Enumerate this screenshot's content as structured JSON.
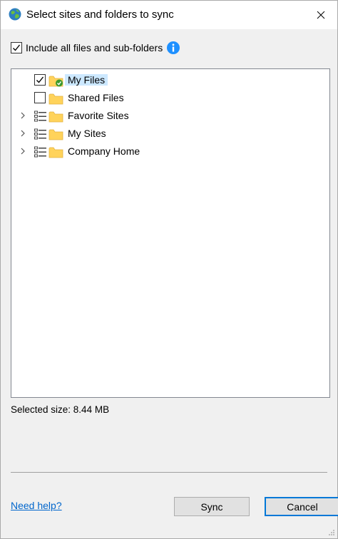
{
  "window": {
    "title": "Select sites and folders to sync"
  },
  "include_option": {
    "label": "Include all files and sub-folders",
    "checked": true
  },
  "tree": {
    "items": [
      {
        "label": "My Files",
        "checked": true,
        "expandable": false,
        "selected": true,
        "status": "synced"
      },
      {
        "label": "Shared Files",
        "checked": false,
        "expandable": false,
        "selected": false
      },
      {
        "label": "Favorite Sites",
        "expandable": true,
        "selected": false
      },
      {
        "label": "My Sites",
        "expandable": true,
        "selected": false
      },
      {
        "label": "Company Home",
        "expandable": true,
        "selected": false
      }
    ]
  },
  "selected_size": "Selected size: 8.44 MB",
  "footer": {
    "help_link": "Need help?",
    "sync_label": "Sync",
    "cancel_label": "Cancel"
  },
  "colors": {
    "selection": "#cce8ff",
    "folder": "#ffd35b",
    "accent": "#0078d7",
    "link": "#0066cc",
    "info": "#1e90ff",
    "synced_badge": "#3c9a2e"
  },
  "icons": {
    "app": "globe-icon",
    "close": "close-icon",
    "info": "info-icon",
    "folder": "folder-icon",
    "list": "list-icon",
    "expander": "chevron-right-icon",
    "synced": "check-badge-icon"
  }
}
